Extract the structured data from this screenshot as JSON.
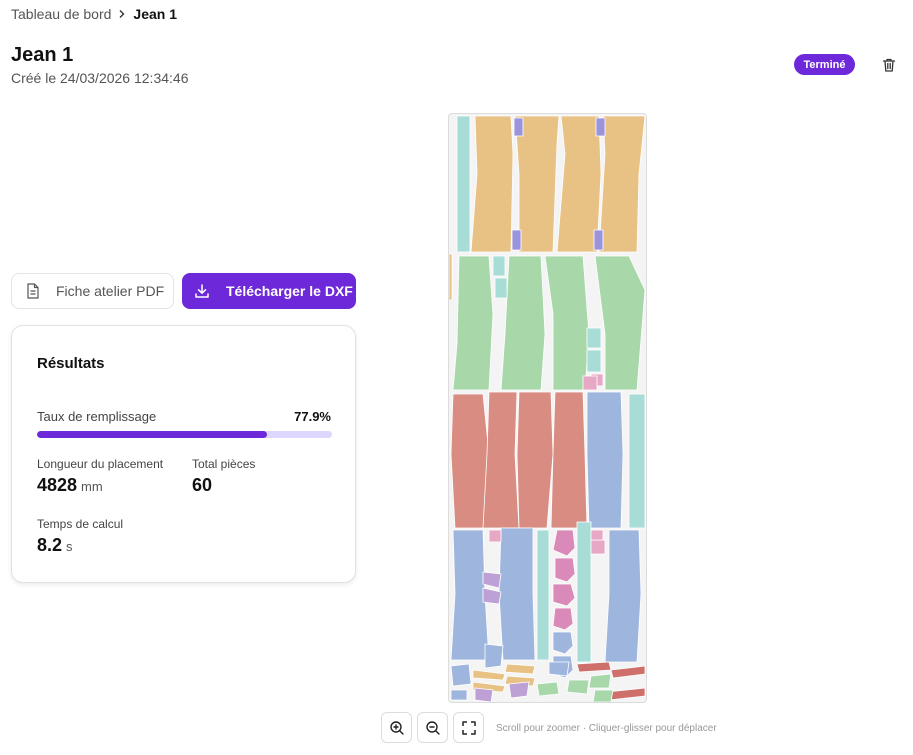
{
  "breadcrumb": {
    "parent": "Tableau de bord",
    "current": "Jean 1"
  },
  "header": {
    "title": "Jean 1",
    "subtitle": "Créé le 24/03/2026 12:34:46",
    "status": "Terminé"
  },
  "actions": {
    "pdf_label": "Fiche atelier PDF",
    "dxf_label": "Télécharger le DXF"
  },
  "results": {
    "title": "Résultats",
    "fill_label": "Taux de remplissage",
    "fill_value": "77.9%",
    "fill_fraction": 0.779,
    "length_label": "Longueur du placement",
    "length_value": "4828",
    "length_unit": "mm",
    "pieces_label": "Total pièces",
    "pieces_value": "60",
    "time_label": "Temps de calcul",
    "time_value": "8.2",
    "time_unit": "s"
  },
  "canvas": {
    "hint": "Scroll pour zoomer · Cliquer-glisser pour déplacer",
    "piece_colors": {
      "orange": "#e8c185",
      "green": "#a8d8aa",
      "red": "#d88c82",
      "blue": "#9eb5de",
      "teal": "#a8dcd6",
      "purple": "#9b93dc",
      "pink": "#e7a8c6",
      "magenta": "#d98ab8",
      "lavender": "#bca0d6",
      "brick": "#cf6f6a"
    }
  },
  "colors": {
    "accent": "#6d28d9",
    "accent_light": "#ddd6fe"
  }
}
